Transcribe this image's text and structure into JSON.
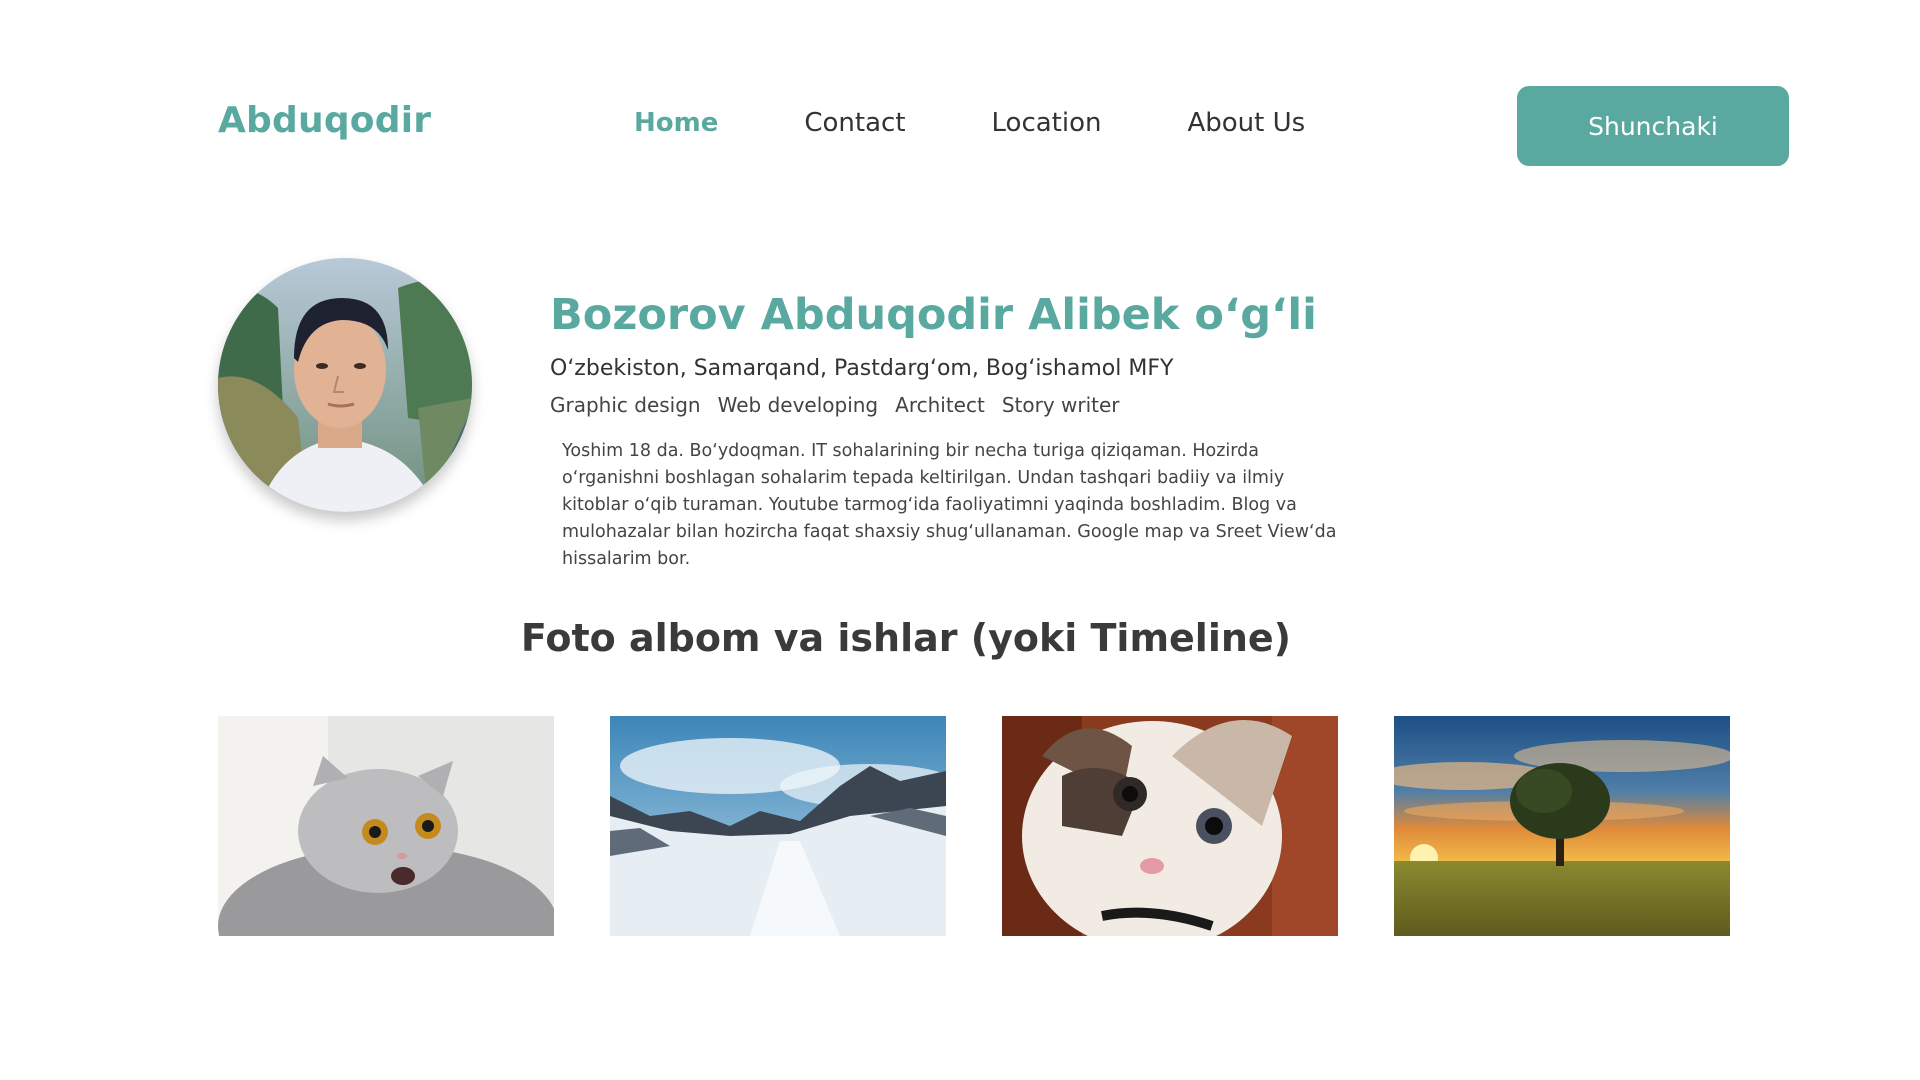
{
  "header": {
    "logo": "Abduqodir",
    "nav": [
      {
        "label": "Home",
        "active": true
      },
      {
        "label": "Contact",
        "active": false
      },
      {
        "label": "Location",
        "active": false
      },
      {
        "label": "About Us",
        "active": false
      }
    ],
    "cta_label": "Shunchaki"
  },
  "profile": {
    "name": "Bozorov Abduqodir Alibek o‘g‘li",
    "location": "O‘zbekiston, Samarqand, Pastdarg‘om, Bog‘ishamol MFY",
    "tags": [
      "Graphic design",
      "Web developing",
      "Architect",
      "Story writer"
    ],
    "bio": "Yoshim 18 da. Bo‘ydoqman. IT sohalarining bir necha turiga qiziqaman. Hozirda o‘rganishni boshlagan sohalarim tepada keltirilgan. Undan tashqari badiiy va ilmiy kitoblar o‘qib turaman. Youtube tarmog‘ida faoliyatimni yaqinda boshladim. Blog va mulohazalar bilan hozircha faqat shaxsiy shug‘ullanaman. Google map va Sreet View‘da hissalarim bor."
  },
  "gallery": {
    "title": "Foto albom va ishlar (yoki Timeline)",
    "photos": [
      "cat-photo",
      "mountain-photo",
      "kitten-photo",
      "tree-sunset-photo"
    ]
  },
  "colors": {
    "accent": "#5aa9a1",
    "text": "#333333",
    "background": "#ffffff"
  }
}
